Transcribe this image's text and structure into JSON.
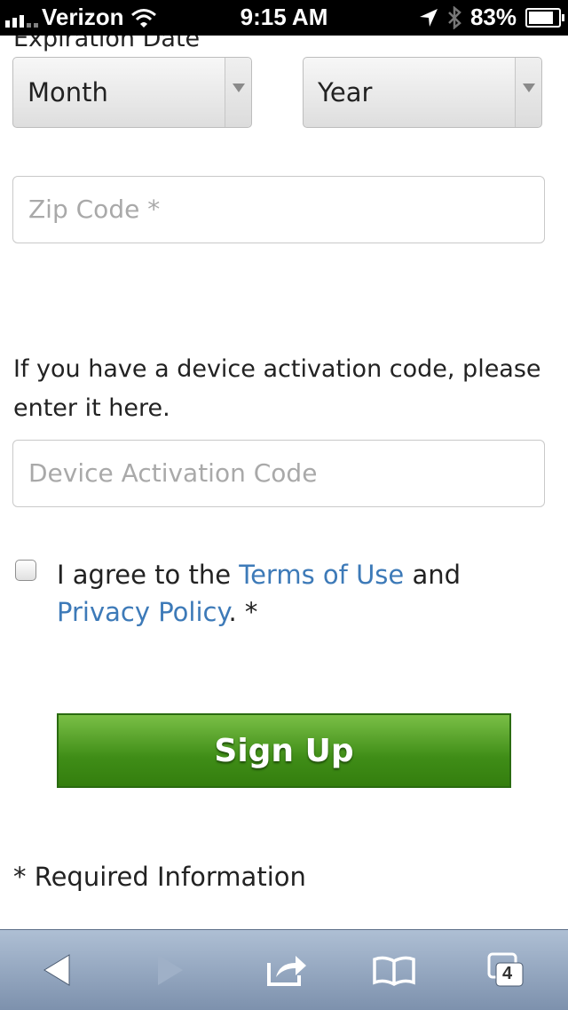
{
  "status_bar": {
    "carrier": "Verizon",
    "time": "9:15 AM",
    "battery": "83%",
    "battery_level": 0.83,
    "icons": [
      "signal-icon",
      "wifi-icon",
      "location-icon",
      "bluetooth-icon",
      "battery-icon"
    ]
  },
  "form": {
    "expiration_label": "Expiration Date",
    "month_select": "Month",
    "year_select": "Year",
    "zip_placeholder": "Zip Code *",
    "activation_text": "If you have a device activation code, please enter it here.",
    "activation_placeholder": "Device Activation Code",
    "agree_prefix": "I agree to the ",
    "terms_link": "Terms of Use",
    "agree_and": " and ",
    "privacy_link": "Privacy Policy",
    "agree_suffix": ". *",
    "signup_label": "Sign Up",
    "required_note": "* Required Information"
  },
  "toolbar": {
    "tabs_count": "4",
    "icons": [
      "back-icon",
      "forward-icon",
      "share-icon",
      "bookmarks-icon",
      "tabs-icon"
    ]
  },
  "colors": {
    "link": "#3d7ab8",
    "button_green": "#4a9a1f",
    "toolbar": "#9aabc3"
  }
}
